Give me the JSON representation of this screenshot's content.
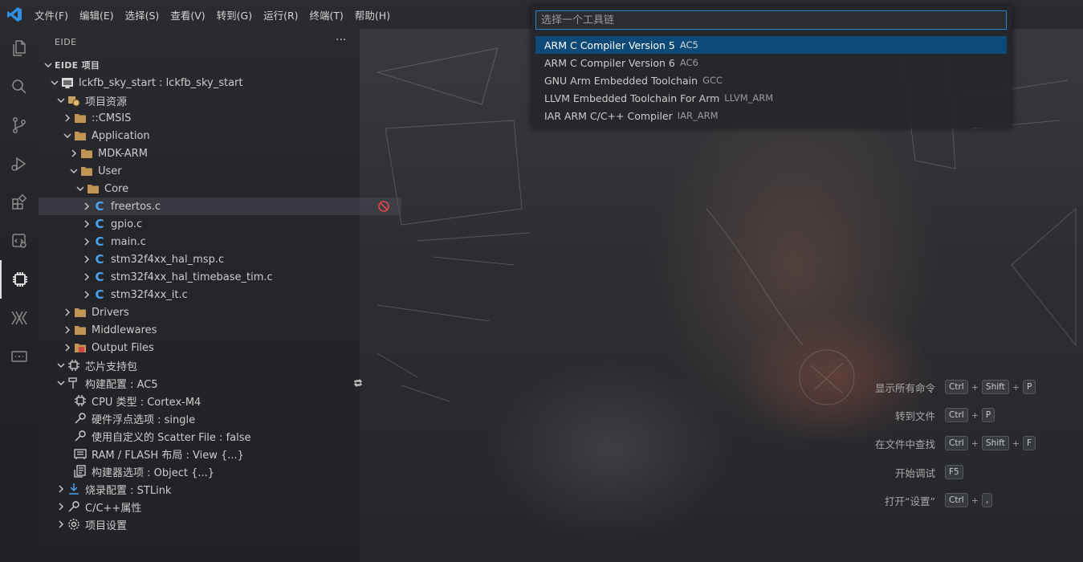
{
  "menu": [
    "文件(F)",
    "编辑(E)",
    "选择(S)",
    "查看(V)",
    "转到(G)",
    "运行(R)",
    "终端(T)",
    "帮助(H)"
  ],
  "sidebar": {
    "title": "EIDE",
    "more": "···",
    "section": "EIDE 项目",
    "rows": [
      {
        "label": "lckfb_sky_start : lckfb_sky_start"
      },
      {
        "label": "项目资源"
      },
      {
        "label": "::CMSIS"
      },
      {
        "label": "Application"
      },
      {
        "label": "MDK-ARM"
      },
      {
        "label": "User"
      },
      {
        "label": "Core"
      },
      {
        "label": "freertos.c"
      },
      {
        "label": "gpio.c"
      },
      {
        "label": "main.c"
      },
      {
        "label": "stm32f4xx_hal_msp.c"
      },
      {
        "label": "stm32f4xx_hal_timebase_tim.c"
      },
      {
        "label": "stm32f4xx_it.c"
      },
      {
        "label": "Drivers"
      },
      {
        "label": "Middlewares"
      },
      {
        "label": "Output Files"
      },
      {
        "label": "芯片支持包"
      },
      {
        "label": "构建配置 : AC5"
      },
      {
        "label": "CPU 类型 : Cortex-M4"
      },
      {
        "label": "硬件浮点选项 : single"
      },
      {
        "label": "使用自定义的 Scatter File : false"
      },
      {
        "label": "RAM / FLASH 布局 : View {...}"
      },
      {
        "label": "构建器选项 : Object {...}"
      },
      {
        "label": "烧录配置 : STLink"
      },
      {
        "label": "C/C++属性"
      },
      {
        "label": "项目设置"
      }
    ]
  },
  "quickpick": {
    "placeholder": "选择一个工具链",
    "items": [
      {
        "label": "ARM C Compiler Version 5",
        "desc": "AC5"
      },
      {
        "label": "ARM C Compiler Version 6",
        "desc": "AC6"
      },
      {
        "label": "GNU Arm Embedded Toolchain",
        "desc": "GCC"
      },
      {
        "label": "LLVM Embedded Toolchain For Arm",
        "desc": "LLVM_ARM"
      },
      {
        "label": "IAR ARM C/C++ Compiler",
        "desc": "IAR_ARM"
      }
    ]
  },
  "watermark": [
    {
      "label": "显示所有命令",
      "keys": [
        "Ctrl",
        "Shift",
        "P"
      ]
    },
    {
      "label": "转到文件",
      "keys": [
        "Ctrl",
        "P"
      ]
    },
    {
      "label": "在文件中查找",
      "keys": [
        "Ctrl",
        "Shift",
        "F"
      ]
    },
    {
      "label": "开始调试",
      "keys": [
        "F5"
      ]
    },
    {
      "label": "打开“设置”",
      "keys": [
        "Ctrl",
        ","
      ]
    }
  ],
  "colors": {
    "accent": "#0e4a78",
    "c_file": "#4aa3f0",
    "folder": "#c09553"
  }
}
